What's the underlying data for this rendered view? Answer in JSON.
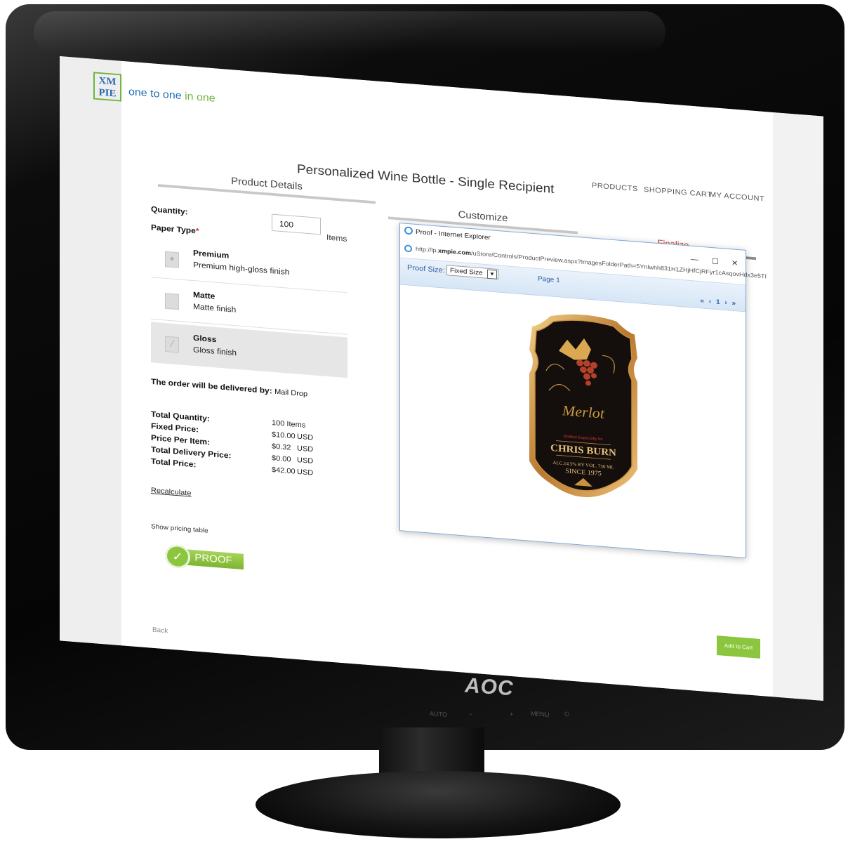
{
  "monitor": {
    "brand": "AOC",
    "controls": [
      "AUTO",
      "−",
      "+",
      "MENU",
      "⏻"
    ]
  },
  "logo": {
    "mark_top": "XM",
    "mark_bottom": "PIE",
    "tagline_a": "one to one",
    "tagline_b": "in one"
  },
  "nav": {
    "products": "PRODUCTS",
    "cart": "SHOPPING CART",
    "account": "MY ACCOUNT"
  },
  "page": {
    "title": "Personalized Wine Bottle - Single Recipient"
  },
  "steps": [
    {
      "label": "Product Details",
      "active": false
    },
    {
      "label": "Customize",
      "active": false
    },
    {
      "label": "Finalize",
      "active": true
    }
  ],
  "form": {
    "quantity_label": "Quantity:",
    "quantity_value": "100",
    "quantity_unit": "Items",
    "paper_type_label": "Paper Type",
    "required_mark": "*",
    "paper_options": [
      {
        "name": "Premium",
        "desc": "Premium high-gloss finish",
        "selected": false
      },
      {
        "name": "Matte",
        "desc": "Matte finish",
        "selected": false
      },
      {
        "name": "Gloss",
        "desc": "Gloss finish",
        "selected": true
      }
    ],
    "delivery_label": "The order will be delivered by:",
    "delivery_value": "Mail Drop"
  },
  "pricing": {
    "rows": [
      {
        "label": "Total Quantity:",
        "value": "100 Items",
        "currency": ""
      },
      {
        "label": "Fixed Price:",
        "value": "$10.00",
        "currency": "USD"
      },
      {
        "label": "Price Per Item:",
        "value": "$0.32",
        "currency": "USD"
      },
      {
        "label": "Total Delivery Price:",
        "value": "$0.00",
        "currency": "USD"
      },
      {
        "label": "Total Price:",
        "value": "$42.00",
        "currency": "USD"
      }
    ],
    "recalculate": "Recalculate",
    "show_table": "Show pricing table"
  },
  "buttons": {
    "proof": "PROOF",
    "add_to_cart": "Add to Cart",
    "back": "Back"
  },
  "popup": {
    "window_title": "Proof - Internet Explorer",
    "url_prefix": "http://lp.",
    "url_domain": "xmpie.com",
    "url_rest": "/uStore/Controls/ProductPreview.aspx?ImagesFolderPath=5Ynlwhh831H1ZHjHfCjRFyr1cAsqovHdx3e5TI",
    "minimize": "—",
    "maximize": "☐",
    "close": "✕",
    "proof_size_label": "Proof Size:",
    "proof_size_value": "Fixed Size",
    "page_indicator": "Page 1",
    "pager_first": "«",
    "pager_prev": "‹",
    "pager_page": "1",
    "pager_next": "›",
    "pager_last": "»"
  },
  "wine_label": {
    "varietal": "Merlot",
    "bottled_for": "Bottled Especially for",
    "recipient": "CHRIS BURN",
    "alcohol": "ALC.14.5% BY VOL. 750 ML",
    "since": "SINCE 1975"
  },
  "colors": {
    "accent_green": "#8cc63f",
    "brand_blue": "#1f6fb5",
    "finalize_red": "#c0392b"
  }
}
